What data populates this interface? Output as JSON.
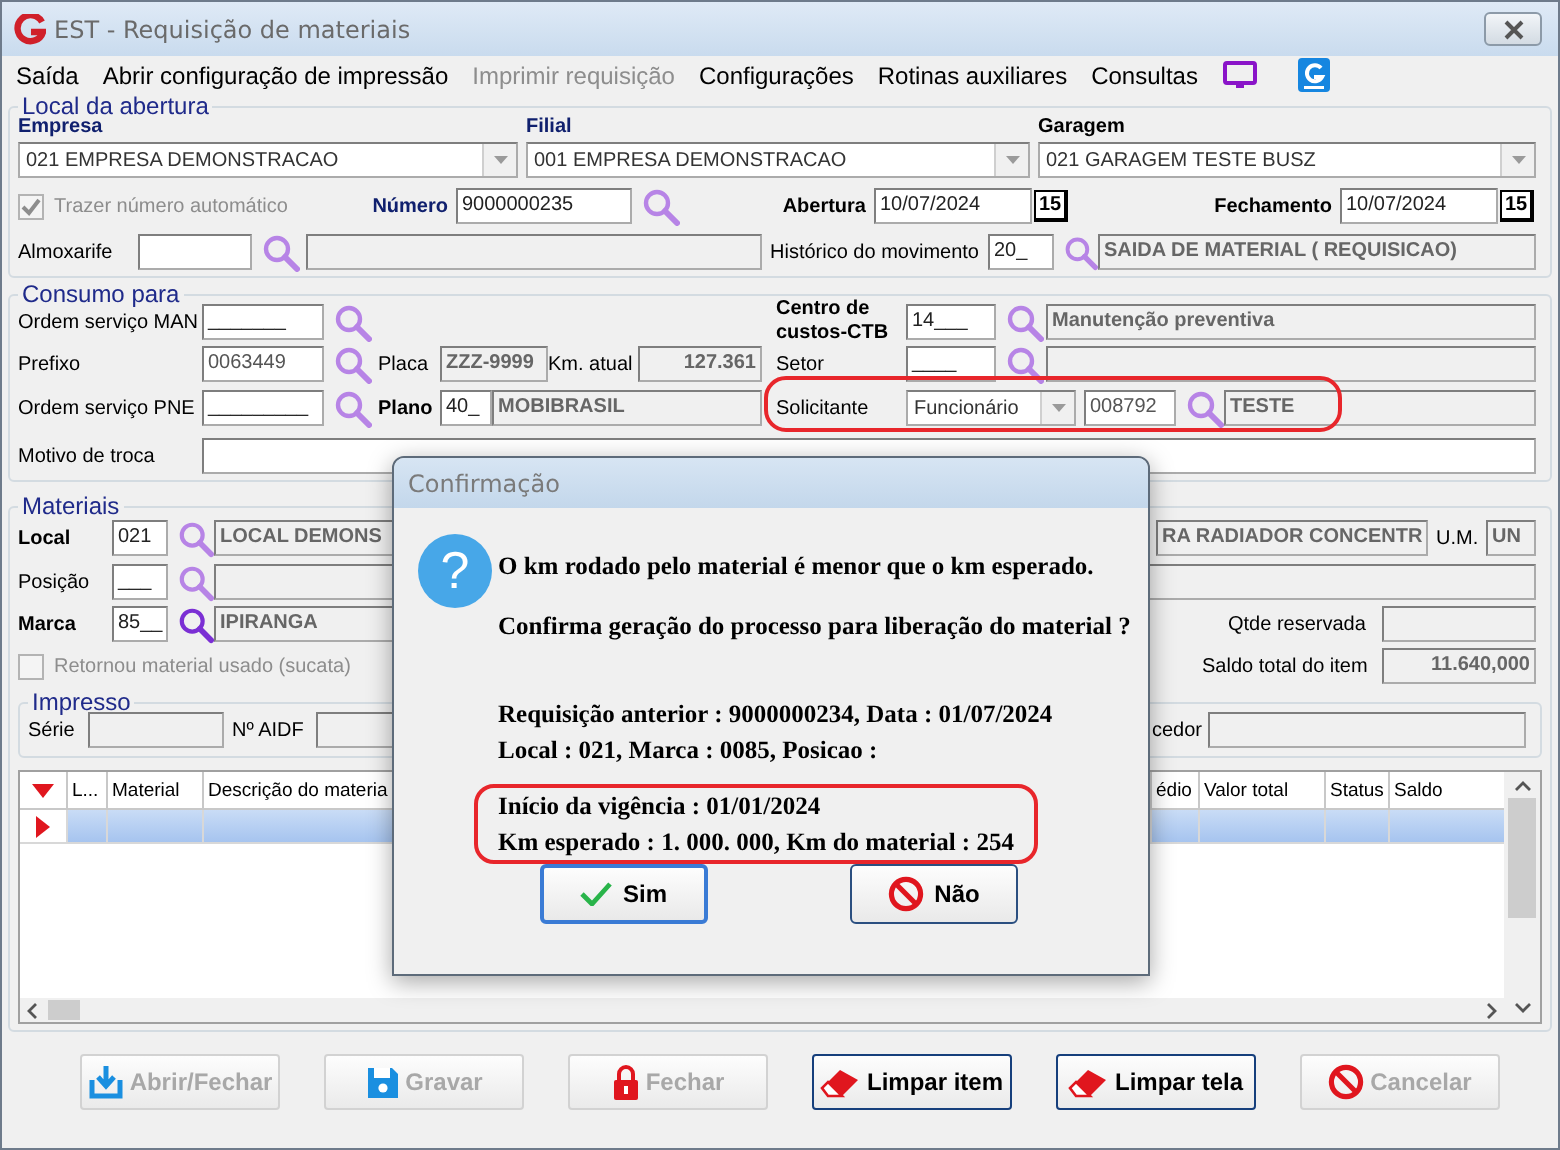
{
  "window": {
    "title": "EST - Requisição de materiais"
  },
  "menu": [
    {
      "label": "Saída",
      "disabled": false
    },
    {
      "label": "Abrir configuração de impressão",
      "disabled": false
    },
    {
      "label": "Imprimir requisição",
      "disabled": true
    },
    {
      "label": "Configurações",
      "disabled": false
    },
    {
      "label": "Rotinas auxiliares",
      "disabled": false
    },
    {
      "label": "Consultas",
      "disabled": false
    }
  ],
  "local_abertura": {
    "title": "Local da abertura",
    "empresa": {
      "label": "Empresa",
      "value": "021 EMPRESA DEMONSTRACAO"
    },
    "filial": {
      "label": "Filial",
      "value": "001 EMPRESA DEMONSTRACAO"
    },
    "garagem": {
      "label": "Garagem",
      "value": "021 GARAGEM TESTE BUSZ"
    },
    "auto_number": {
      "label": "Trazer número automático",
      "checked": true,
      "disabled": true
    },
    "numero": {
      "label": "Número",
      "value": "9000000235"
    },
    "abertura": {
      "label": "Abertura",
      "value": "10/07/2024",
      "calendar": "15"
    },
    "fechamento": {
      "label": "Fechamento",
      "value": "10/07/2024",
      "calendar": "15"
    },
    "almoxarife": {
      "label": "Almoxarife"
    },
    "historico": {
      "label": "Histórico do movimento",
      "code": "20_",
      "description": "SAIDA DE MATERIAL ( REQUISICAO)"
    }
  },
  "consumo": {
    "title": "Consumo para",
    "os_man": {
      "label": "Ordem serviço MAN",
      "value": "_______"
    },
    "centro_custos": {
      "label": "Centro de custos-CTB",
      "code": "14___",
      "description": "Manutenção preventiva"
    },
    "prefixo": {
      "label": "Prefixo",
      "value": "0063449"
    },
    "placa": {
      "label": "Placa",
      "value": "ZZZ-9999"
    },
    "km_atual": {
      "label": "Km. atual",
      "value": "127.361"
    },
    "setor": {
      "label": "Setor",
      "code": "____"
    },
    "os_pne": {
      "label": "Ordem serviço PNE",
      "value": "_________"
    },
    "plano": {
      "label": "Plano",
      "code": "40_",
      "description": "MOBIBRASIL"
    },
    "solicitante": {
      "label": "Solicitante",
      "type": "Funcionário",
      "code": "008792",
      "name": "TESTE",
      "highlighted": true
    },
    "motivo": {
      "label": "Motivo de troca"
    }
  },
  "materiais": {
    "title": "Materiais",
    "local": {
      "label": "Local",
      "code": "021",
      "description": "LOCAL DEMONS"
    },
    "material_description": "RA RADIADOR CONCENTR",
    "um": {
      "label": "U.M.",
      "value": "UN"
    },
    "posicao": {
      "label": "Posição",
      "code": "___"
    },
    "marca": {
      "label": "Marca",
      "code": "85__",
      "description": "IPIRANGA"
    },
    "qtde_reservada": {
      "label": "Qtde reservada"
    },
    "sucata": {
      "label": "Retornou material usado (sucata)",
      "checked": false,
      "disabled": true
    },
    "saldo_total": {
      "label": "Saldo total do item",
      "value": "11.640,000"
    },
    "impresso": {
      "title": "Impresso",
      "serie": {
        "label": "Série"
      },
      "aidf": {
        "label": "Nº AIDF"
      },
      "fornecedor": {
        "label": "cedor"
      }
    },
    "table": {
      "columns": [
        "L...",
        "Material",
        "Descrição do materia",
        "édio",
        "Valor total",
        "Status",
        "Saldo"
      ],
      "rows": [
        {
          "selected": true
        }
      ]
    }
  },
  "buttons": [
    {
      "label": "Abrir/Fechar",
      "kind": "download",
      "disabled": true
    },
    {
      "label": "Gravar",
      "kind": "save",
      "disabled": true
    },
    {
      "label": "Fechar",
      "kind": "lock",
      "disabled": true
    },
    {
      "label": "Limpar item",
      "kind": "eraser",
      "disabled": false
    },
    {
      "label": "Limpar tela",
      "kind": "eraser",
      "disabled": false
    },
    {
      "label": "Cancelar",
      "kind": "cancel",
      "disabled": true
    }
  ],
  "dialog": {
    "title": "Confirmação",
    "icon_glyph": "?",
    "message": "O km rodado pelo material é menor que o km esperado.",
    "question": "Confirma geração do processo para liberação do material ?",
    "details": [
      {
        "lines": [
          "Requisição anterior : 9000000234,  Data : 01/07/2024",
          "Local : 021,  Marca : 0085,  Posicao :"
        ],
        "highlighted": false
      },
      {
        "lines": [
          "Início da vigência : 01/01/2024",
          "Km esperado : 1. 000. 000,  Km do material : 254"
        ],
        "highlighted": true
      }
    ],
    "buttons": [
      {
        "label": "Sim",
        "kind": "check",
        "selected": true
      },
      {
        "label": "Não",
        "kind": "no",
        "selected": false
      }
    ]
  }
}
